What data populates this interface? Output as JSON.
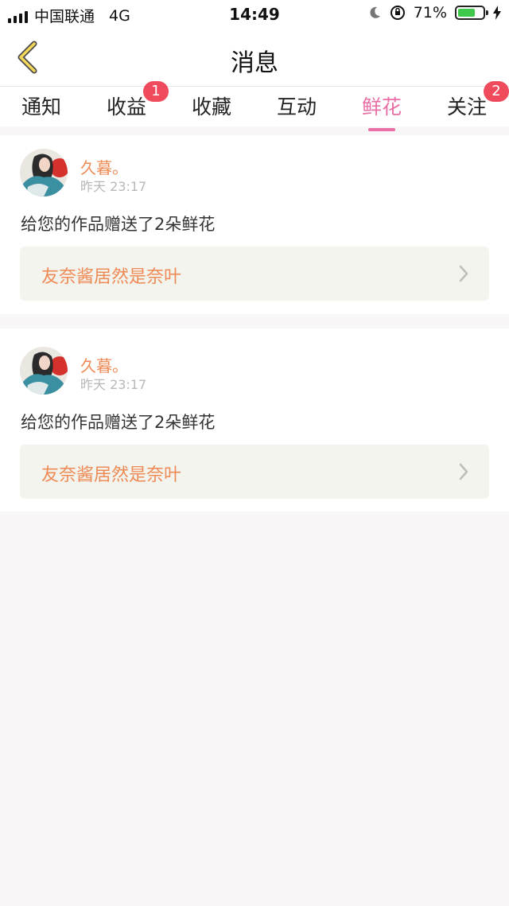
{
  "status_bar": {
    "carrier": "中国联通",
    "network": "4G",
    "time": "14:49",
    "battery_percent": "71%",
    "battery_level": 0.71
  },
  "nav": {
    "title": "消息"
  },
  "tabs": [
    {
      "label": "通知",
      "badge": ""
    },
    {
      "label": "收益",
      "badge": "1"
    },
    {
      "label": "收藏",
      "badge": ""
    },
    {
      "label": "互动",
      "badge": ""
    },
    {
      "label": "鲜花",
      "badge": "",
      "active": true
    },
    {
      "label": "关注",
      "badge": "2"
    }
  ],
  "colors": {
    "accent": "#e86fa6",
    "name": "#ee8a55",
    "badge": "#f04b5d",
    "background": "#f8f6f6"
  },
  "messages": [
    {
      "username": "久暮。",
      "time": "昨天 23:17",
      "text": "给您的作品赠送了2朵鲜花",
      "work_title": "友奈酱居然是奈叶"
    },
    {
      "username": "久暮。",
      "time": "昨天 23:17",
      "text": "给您的作品赠送了2朵鲜花",
      "work_title": "友奈酱居然是奈叶"
    }
  ]
}
